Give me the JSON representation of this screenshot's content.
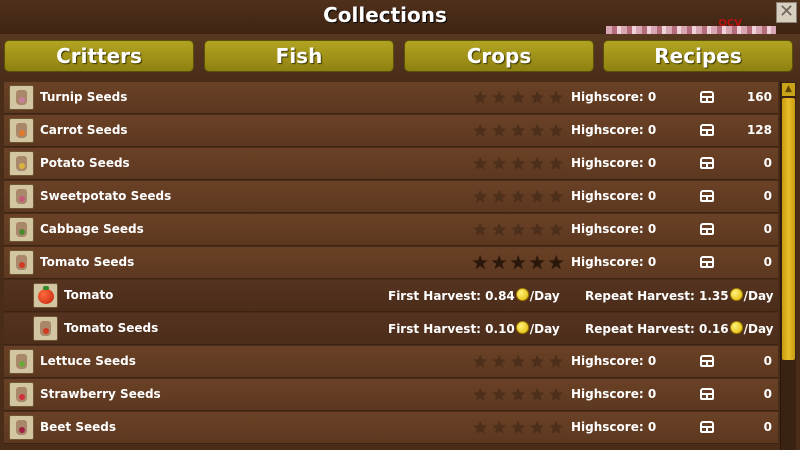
{
  "window": {
    "title": "Collections",
    "close_label": "✕",
    "deco_text": "OCV"
  },
  "tabs": [
    {
      "label": "Critters"
    },
    {
      "label": "Fish"
    },
    {
      "label": "Crops"
    },
    {
      "label": "Recipes"
    }
  ],
  "rows": [
    {
      "name": "Turnip Seeds",
      "highscore": "Highscore: 0",
      "count": "160",
      "seed_color": "#c9809a",
      "stars": 0
    },
    {
      "name": "Carrot Seeds",
      "highscore": "Highscore: 0",
      "count": "128",
      "seed_color": "#e07a2a",
      "stars": 0
    },
    {
      "name": "Potato Seeds",
      "highscore": "Highscore: 0",
      "count": "0",
      "seed_color": "#d9b23c",
      "stars": 0
    },
    {
      "name": "Sweetpotato Seeds",
      "highscore": "Highscore: 0",
      "count": "0",
      "seed_color": "#c45a7a",
      "stars": 0
    },
    {
      "name": "Cabbage Seeds",
      "highscore": "Highscore: 0",
      "count": "0",
      "seed_color": "#4c8a30",
      "stars": 0
    },
    {
      "name": "Tomato Seeds",
      "highscore": "Highscore: 0",
      "count": "0",
      "seed_color": "#d03a20",
      "stars": 0
    }
  ],
  "tomato_details": [
    {
      "name": "Tomato",
      "first": "First Harvest: 0.84",
      "first_unit": "/Day",
      "repeat": "Repeat Harvest: 1.35",
      "repeat_unit": "/Day",
      "icon": "tomato-icon"
    },
    {
      "name": "Tomato Seeds",
      "first": "First Harvest: 0.10",
      "first_unit": "/Day",
      "repeat": "Repeat Harvest: 0.16",
      "repeat_unit": "/Day",
      "icon": "seed-bag-icon"
    }
  ],
  "rows_after": [
    {
      "name": "Lettuce Seeds",
      "highscore": "Highscore: 0",
      "count": "0",
      "seed_color": "#6aa83a",
      "stars": 0
    },
    {
      "name": "Strawberry Seeds",
      "highscore": "Highscore: 0",
      "count": "0",
      "seed_color": "#d0303a",
      "stars": 0
    },
    {
      "name": "Beet Seeds",
      "highscore": "Highscore: 0",
      "count": "0",
      "seed_color": "#a02040",
      "stars": 0
    }
  ],
  "icons": {
    "star": "★",
    "scroll_up": "▲"
  },
  "colors": {
    "tab": "#a89a1a",
    "scroll_thumb": "#dbb020"
  }
}
